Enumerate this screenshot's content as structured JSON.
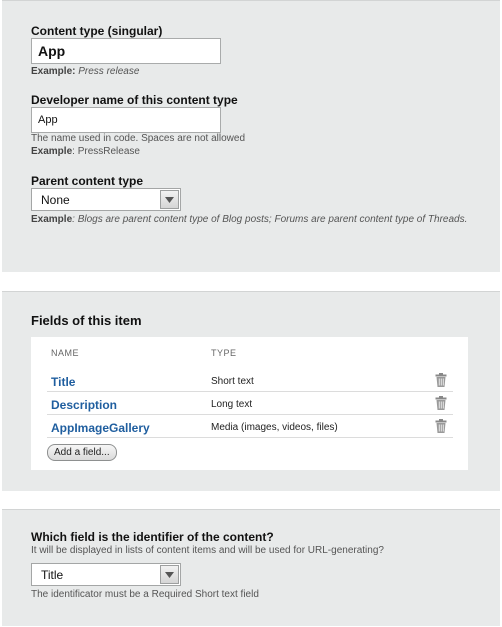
{
  "content_type": {
    "singular_label": "Content type (singular)",
    "singular_value": "App",
    "singular_example_label": "Example:",
    "singular_example_value": "Press release",
    "devname_label": "Developer name of this content type",
    "devname_value": "App",
    "devname_help": "The name used in code. Spaces are not allowed",
    "devname_example_label": "Example",
    "devname_example_value": ": PressRelease",
    "parent_label": "Parent content type",
    "parent_value": "None",
    "parent_example_label": "Example",
    "parent_example_value": ": Blogs are parent content type of Blog posts; Forums are parent content type of Threads."
  },
  "fields": {
    "title": "Fields of this item",
    "columns": {
      "name": "NAME",
      "type": "TYPE"
    },
    "rows": [
      {
        "name": "Title",
        "type": "Short text"
      },
      {
        "name": "Description",
        "type": "Long text"
      },
      {
        "name": "AppImageGallery",
        "type": "Media (images, videos, files)"
      }
    ],
    "add_button": "Add a field..."
  },
  "identifier": {
    "label": "Which field is the identifier of the content?",
    "help": "It will be displayed in lists of content items and will be used for URL-generating?",
    "value": "Title",
    "note": "The identificator must be a Required Short text field"
  },
  "icons": {
    "dropdown": "chevron-down-icon",
    "delete": "trash-icon"
  }
}
